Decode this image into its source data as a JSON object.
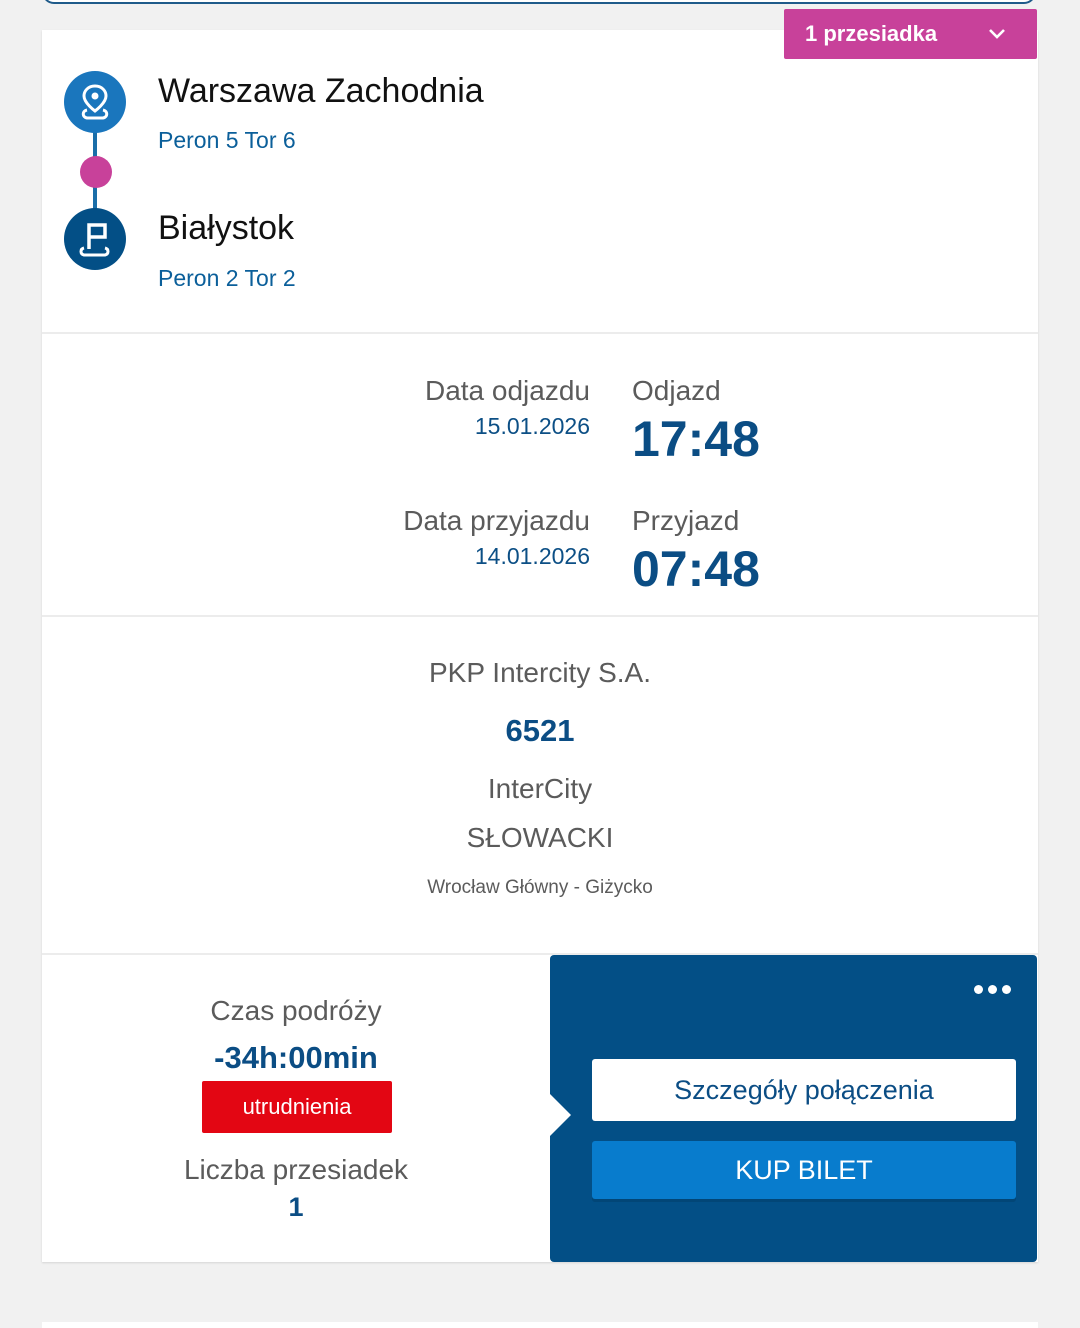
{
  "transfer_badge": {
    "label": "1 przesiadka",
    "icon": "chevron-down-icon"
  },
  "route": {
    "from": {
      "name": "Warszawa Zachodnia",
      "platform": "Peron 5 Tor 6",
      "icon": "map-pin-icon"
    },
    "to": {
      "name": "Białystok",
      "platform": "Peron 2 Tor 2",
      "icon": "flag-icon"
    }
  },
  "departure": {
    "date_label": "Data odjazdu",
    "date": "15.01.2026",
    "time_label": "Odjazd",
    "time": "17:48"
  },
  "arrival": {
    "date_label": "Data przyjazdu",
    "date": "14.01.2026",
    "time_label": "Przyjazd",
    "time": "07:48"
  },
  "train": {
    "carrier": "PKP Intercity S.A.",
    "number": "6521",
    "category": "InterCity",
    "name": "SŁOWACKI",
    "relation": "Wrocław Główny - Giżycko"
  },
  "summary": {
    "duration_label": "Czas podróży",
    "duration": "-34h:00min",
    "alert": "utrudnienia",
    "transfers_label": "Liczba przesiadek",
    "transfers": "1"
  },
  "actions": {
    "details": "Szczegóły połączenia",
    "buy": "KUP BILET",
    "more_icon": "more-dots-icon"
  },
  "colors": {
    "accent_pink": "#c8419a",
    "brand_blue": "#034f86",
    "button_blue": "#087ccd",
    "alert_red": "#e30613"
  }
}
